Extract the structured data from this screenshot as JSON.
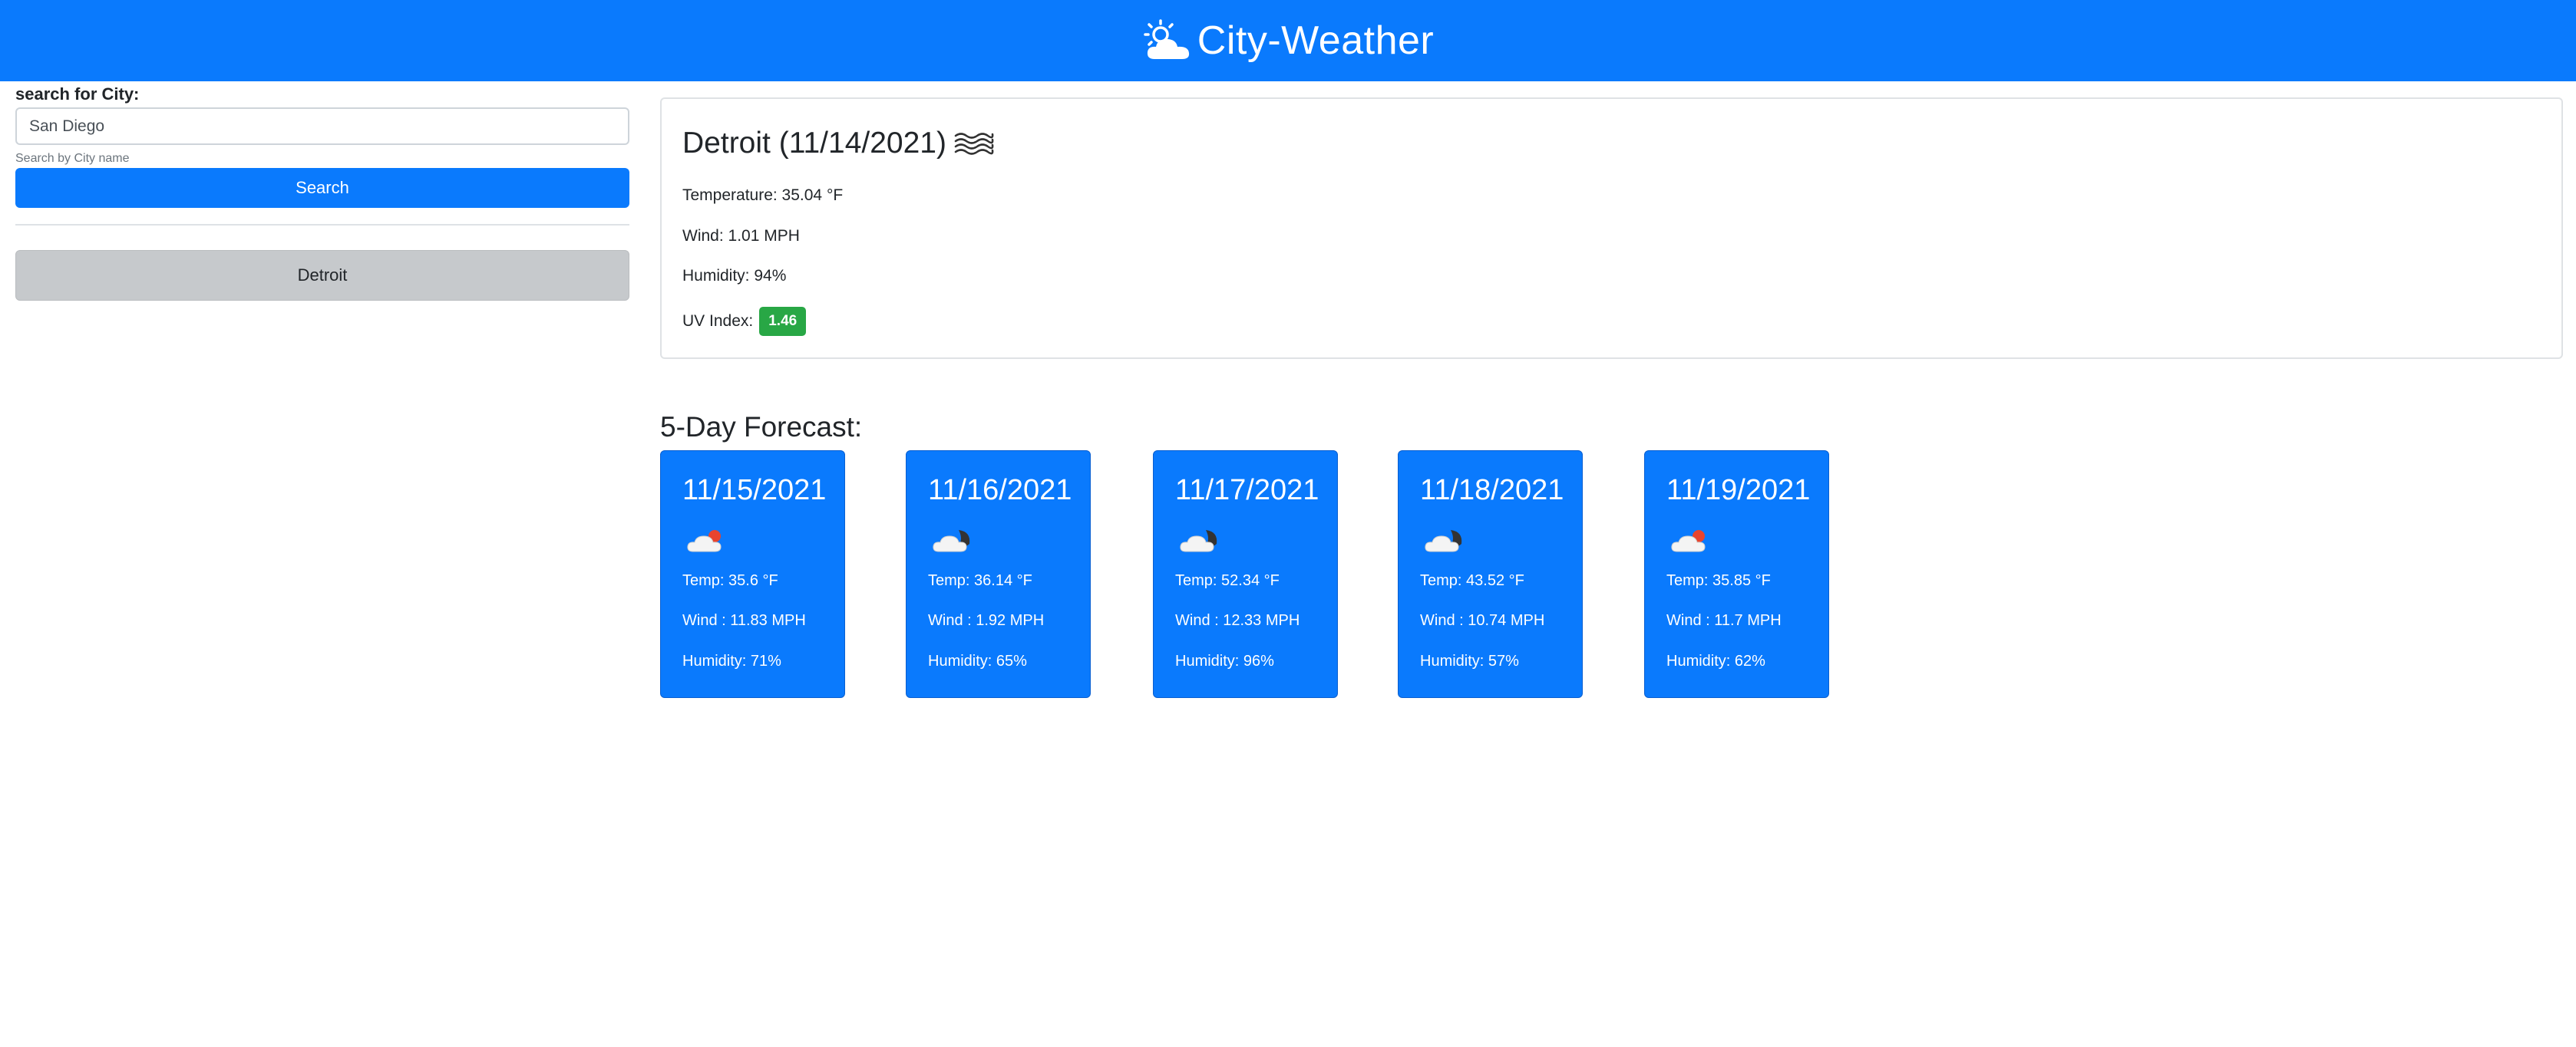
{
  "header": {
    "title": "City-Weather",
    "icon": "sun-behind-cloud-icon",
    "background_color": "#0a7afd"
  },
  "sidebar": {
    "search_label": "search for City:",
    "search_value": "San Diego",
    "search_help": "Search by City name",
    "search_button": "Search",
    "history": [
      "Detroit"
    ]
  },
  "current": {
    "title": "Detroit (11/14/2021)",
    "icon": "mist-icon",
    "temperature": "Temperature: 35.04 °F",
    "wind": "Wind: 1.01 MPH",
    "humidity": "Humidity: 94%",
    "uv_label": "UV Index:",
    "uv_value": "1.46",
    "uv_color": "#28a745"
  },
  "forecast": {
    "heading": "5-Day Forecast:",
    "days": [
      {
        "date": "11/15/2021",
        "icon": "cloud-sun-icon",
        "temp": "Temp: 35.6 °F",
        "wind": "Wind : 11.83 MPH",
        "humidity": "Humidity: 71%"
      },
      {
        "date": "11/16/2021",
        "icon": "cloud-moon-icon",
        "temp": "Temp: 36.14 °F",
        "wind": "Wind : 1.92 MPH",
        "humidity": "Humidity: 65%"
      },
      {
        "date": "11/17/2021",
        "icon": "cloud-moon-icon",
        "temp": "Temp: 52.34 °F",
        "wind": "Wind : 12.33 MPH",
        "humidity": "Humidity: 96%"
      },
      {
        "date": "11/18/2021",
        "icon": "cloud-moon-icon",
        "temp": "Temp: 43.52 °F",
        "wind": "Wind : 10.74 MPH",
        "humidity": "Humidity: 57%"
      },
      {
        "date": "11/19/2021",
        "icon": "cloud-sun-icon",
        "temp": "Temp: 35.85 °F",
        "wind": "Wind : 11.7 MPH",
        "humidity": "Humidity: 62%"
      }
    ]
  }
}
